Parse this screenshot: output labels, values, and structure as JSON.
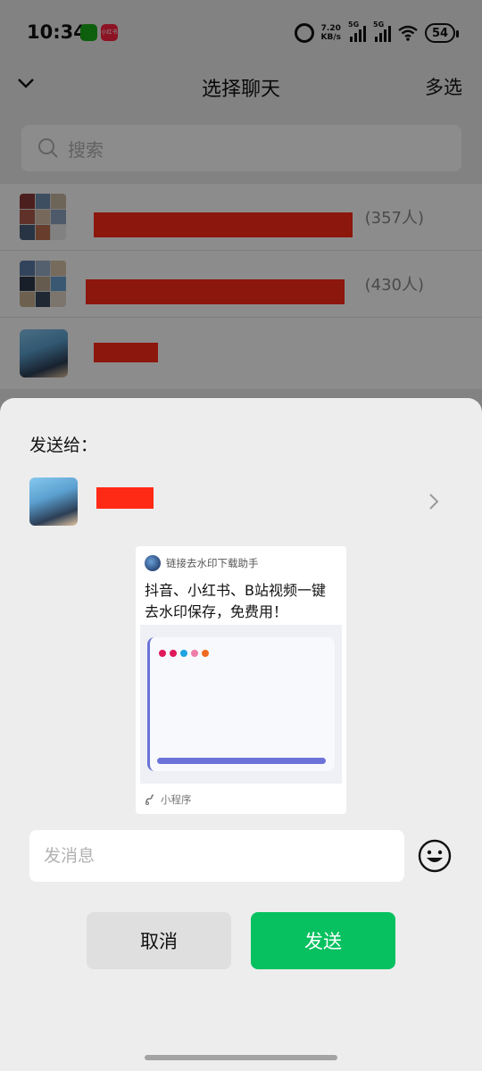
{
  "status_bar": {
    "time": "10:34",
    "xhs_badge": "小红书",
    "net_speed_value": "7.20",
    "net_speed_unit": "KB/s",
    "signal1_label": "5G",
    "signal2_label": "5G",
    "battery": "54"
  },
  "nav": {
    "title": "选择聊天",
    "multi_select": "多选"
  },
  "search": {
    "placeholder": "搜索"
  },
  "chats": [
    {
      "name": "",
      "count": "(357人)"
    },
    {
      "name": "",
      "count": "(430人)"
    },
    {
      "name": ""
    }
  ],
  "sheet": {
    "title": "发送给：",
    "recipient_name": "",
    "card": {
      "app_name": "链接去水印下载助手",
      "text": "抖音、小红书、B站视频一键去水印保存，免费用！",
      "footer": "小程序",
      "dot_colors": [
        "#e0195a",
        "#e0195a",
        "#1ea3e0",
        "#f07ca8",
        "#f06a1e"
      ]
    },
    "message_placeholder": "发消息",
    "cancel": "取消",
    "send": "发送"
  },
  "colors": {
    "send_green": "#07c160",
    "redaction_red": "#ff2a16",
    "accent_purple": "#6b73d9"
  }
}
